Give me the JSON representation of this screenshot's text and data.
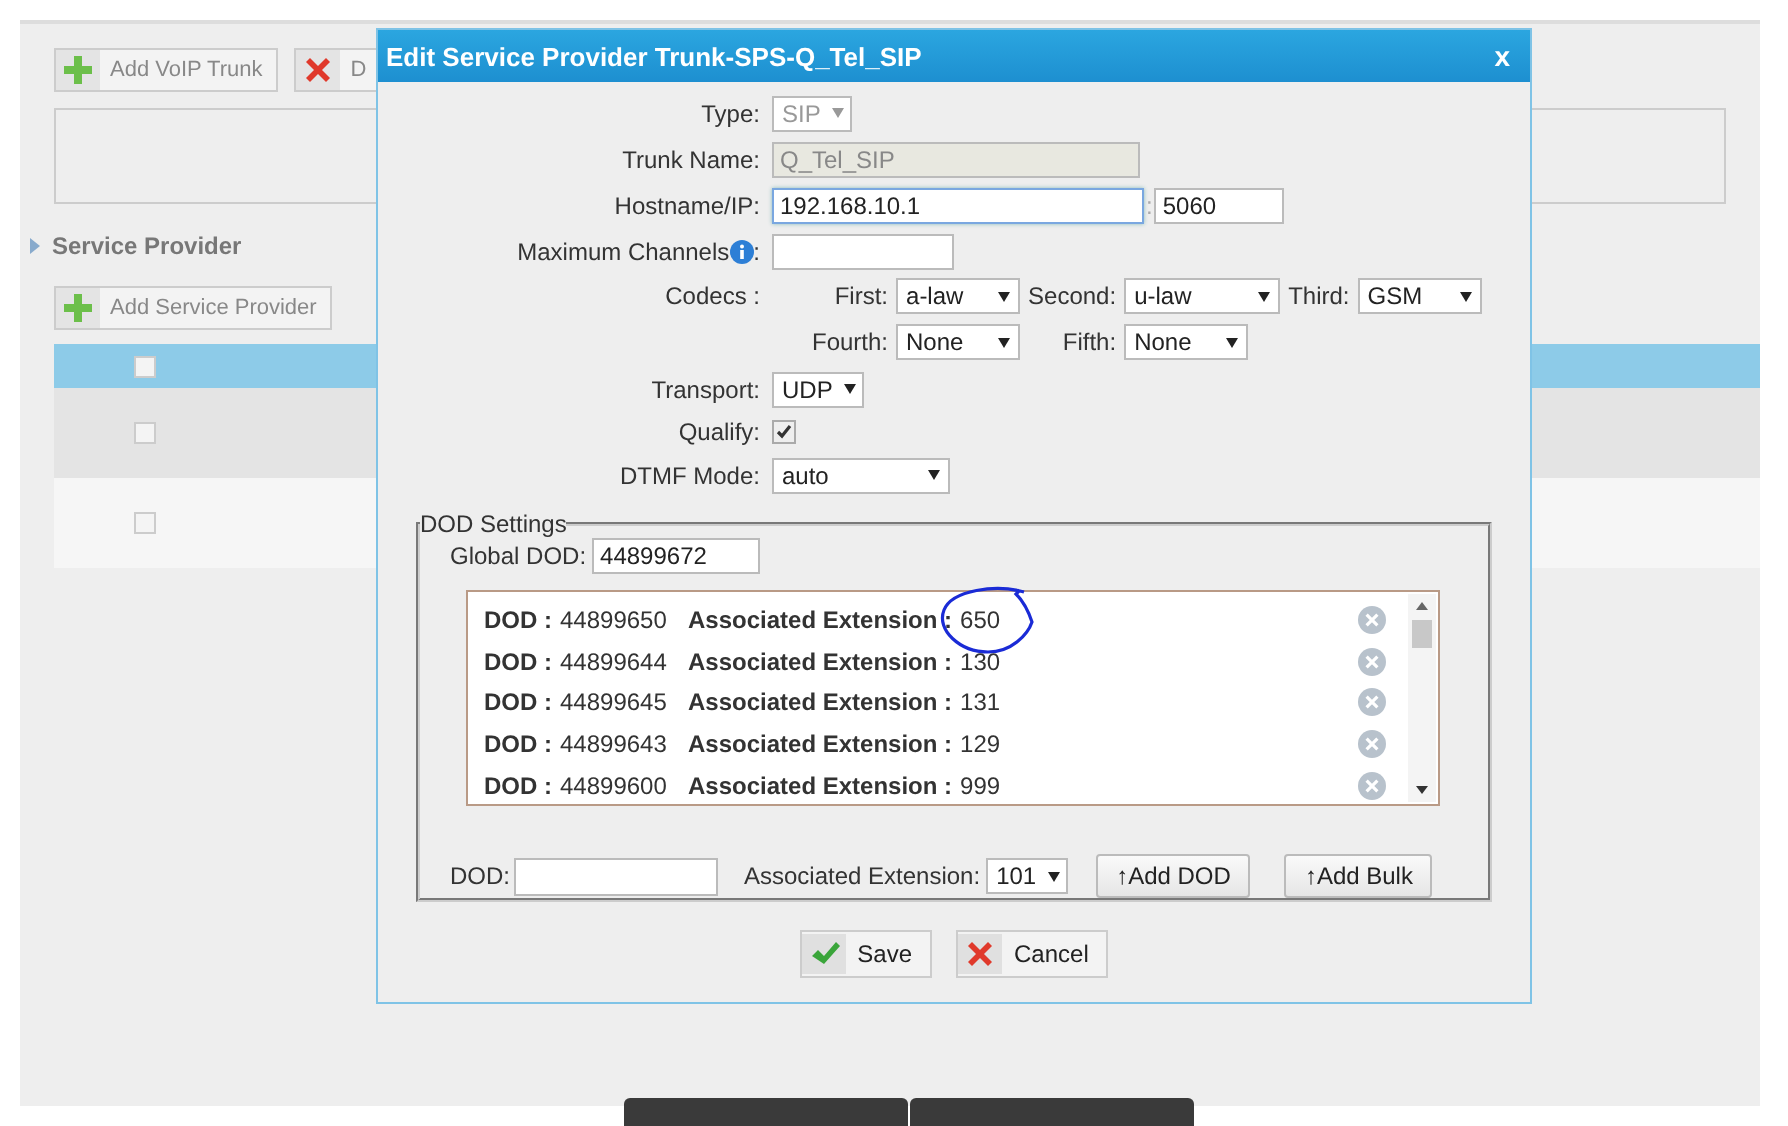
{
  "background": {
    "toolbar": [
      {
        "label": "Add VoIP Trunk",
        "kind": "add"
      },
      {
        "label": "D",
        "kind": "delete"
      }
    ],
    "section_title": "Service Provider",
    "provider_toolbar": [
      {
        "label": "Add Service Provider",
        "kind": "add"
      }
    ],
    "table": {
      "header_checked": false,
      "rows": [
        {
          "checked": false
        },
        {
          "checked": false
        }
      ]
    }
  },
  "dialog": {
    "title": "Edit Service Provider Trunk-SPS-Q_Tel_SIP",
    "close": "x",
    "type": {
      "label": "Type:",
      "value": "SIP",
      "disabled": true
    },
    "trunk_name": {
      "label": "Trunk Name:",
      "value": "Q_Tel_SIP",
      "disabled": true
    },
    "hostname": {
      "label": "Hostname/IP:",
      "value": "192.168.10.1",
      "separator": ":",
      "port": "5060"
    },
    "max_channels": {
      "label": "Maximum Channels",
      "suffix": ":"
    },
    "codecs": {
      "label": "Codecs :",
      "items": [
        {
          "label": "First:",
          "value": "a-law"
        },
        {
          "label": "Second:",
          "value": "u-law"
        },
        {
          "label": "Third:",
          "value": "GSM"
        },
        {
          "label": "Fourth:",
          "value": "None"
        },
        {
          "label": "Fifth:",
          "value": "None"
        }
      ]
    },
    "transport": {
      "label": "Transport:",
      "value": "UDP"
    },
    "qualify": {
      "label": "Qualify:",
      "checked": true
    },
    "dtmf": {
      "label": "DTMF Mode:",
      "value": "auto"
    },
    "dod": {
      "legend": "DOD Settings",
      "global_label": "Global DOD:",
      "global_value": "44899672",
      "entries": [
        {
          "dod_label": "DOD :",
          "dod": "44899650",
          "ext_label": "Associated Extension :",
          "ext": "650",
          "circled": true
        },
        {
          "dod_label": "DOD :",
          "dod": "44899644",
          "ext_label": "Associated Extension :",
          "ext": "130",
          "circled": false
        },
        {
          "dod_label": "DOD :",
          "dod": "44899645",
          "ext_label": "Associated Extension :",
          "ext": "131",
          "circled": false
        },
        {
          "dod_label": "DOD :",
          "dod": "44899643",
          "ext_label": "Associated Extension :",
          "ext": "129",
          "circled": false
        },
        {
          "dod_label": "DOD :",
          "dod": "44899600",
          "ext_label": "Associated Extension :",
          "ext": "999",
          "circled": false
        }
      ],
      "add_dod_label": "DOD:",
      "add_ext_label": "Associated Extension:",
      "add_ext_value": "101",
      "buttons": [
        "↑Add DOD",
        "↑Add Bulk"
      ]
    },
    "footer": [
      {
        "label": "Save",
        "kind": "save"
      },
      {
        "label": "Cancel",
        "kind": "cancel"
      }
    ]
  }
}
